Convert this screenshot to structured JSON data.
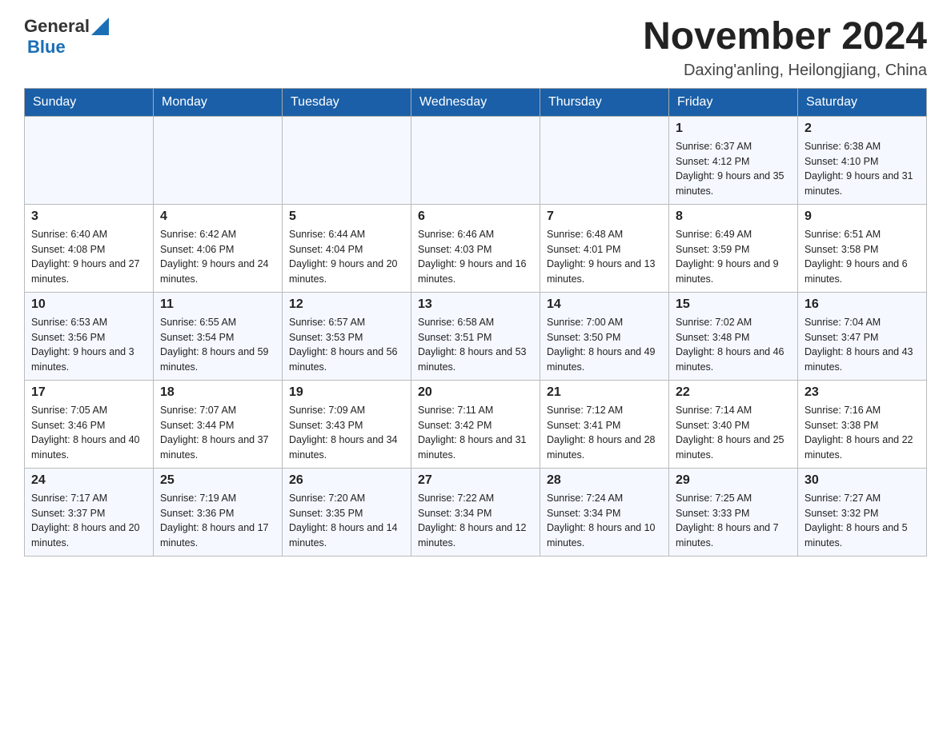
{
  "header": {
    "logo_general": "General",
    "logo_blue": "Blue",
    "month_title": "November 2024",
    "location": "Daxing'anling, Heilongjiang, China"
  },
  "weekdays": [
    "Sunday",
    "Monday",
    "Tuesday",
    "Wednesday",
    "Thursday",
    "Friday",
    "Saturday"
  ],
  "weeks": [
    [
      {
        "day": "",
        "info": ""
      },
      {
        "day": "",
        "info": ""
      },
      {
        "day": "",
        "info": ""
      },
      {
        "day": "",
        "info": ""
      },
      {
        "day": "",
        "info": ""
      },
      {
        "day": "1",
        "info": "Sunrise: 6:37 AM\nSunset: 4:12 PM\nDaylight: 9 hours and 35 minutes."
      },
      {
        "day": "2",
        "info": "Sunrise: 6:38 AM\nSunset: 4:10 PM\nDaylight: 9 hours and 31 minutes."
      }
    ],
    [
      {
        "day": "3",
        "info": "Sunrise: 6:40 AM\nSunset: 4:08 PM\nDaylight: 9 hours and 27 minutes."
      },
      {
        "day": "4",
        "info": "Sunrise: 6:42 AM\nSunset: 4:06 PM\nDaylight: 9 hours and 24 minutes."
      },
      {
        "day": "5",
        "info": "Sunrise: 6:44 AM\nSunset: 4:04 PM\nDaylight: 9 hours and 20 minutes."
      },
      {
        "day": "6",
        "info": "Sunrise: 6:46 AM\nSunset: 4:03 PM\nDaylight: 9 hours and 16 minutes."
      },
      {
        "day": "7",
        "info": "Sunrise: 6:48 AM\nSunset: 4:01 PM\nDaylight: 9 hours and 13 minutes."
      },
      {
        "day": "8",
        "info": "Sunrise: 6:49 AM\nSunset: 3:59 PM\nDaylight: 9 hours and 9 minutes."
      },
      {
        "day": "9",
        "info": "Sunrise: 6:51 AM\nSunset: 3:58 PM\nDaylight: 9 hours and 6 minutes."
      }
    ],
    [
      {
        "day": "10",
        "info": "Sunrise: 6:53 AM\nSunset: 3:56 PM\nDaylight: 9 hours and 3 minutes."
      },
      {
        "day": "11",
        "info": "Sunrise: 6:55 AM\nSunset: 3:54 PM\nDaylight: 8 hours and 59 minutes."
      },
      {
        "day": "12",
        "info": "Sunrise: 6:57 AM\nSunset: 3:53 PM\nDaylight: 8 hours and 56 minutes."
      },
      {
        "day": "13",
        "info": "Sunrise: 6:58 AM\nSunset: 3:51 PM\nDaylight: 8 hours and 53 minutes."
      },
      {
        "day": "14",
        "info": "Sunrise: 7:00 AM\nSunset: 3:50 PM\nDaylight: 8 hours and 49 minutes."
      },
      {
        "day": "15",
        "info": "Sunrise: 7:02 AM\nSunset: 3:48 PM\nDaylight: 8 hours and 46 minutes."
      },
      {
        "day": "16",
        "info": "Sunrise: 7:04 AM\nSunset: 3:47 PM\nDaylight: 8 hours and 43 minutes."
      }
    ],
    [
      {
        "day": "17",
        "info": "Sunrise: 7:05 AM\nSunset: 3:46 PM\nDaylight: 8 hours and 40 minutes."
      },
      {
        "day": "18",
        "info": "Sunrise: 7:07 AM\nSunset: 3:44 PM\nDaylight: 8 hours and 37 minutes."
      },
      {
        "day": "19",
        "info": "Sunrise: 7:09 AM\nSunset: 3:43 PM\nDaylight: 8 hours and 34 minutes."
      },
      {
        "day": "20",
        "info": "Sunrise: 7:11 AM\nSunset: 3:42 PM\nDaylight: 8 hours and 31 minutes."
      },
      {
        "day": "21",
        "info": "Sunrise: 7:12 AM\nSunset: 3:41 PM\nDaylight: 8 hours and 28 minutes."
      },
      {
        "day": "22",
        "info": "Sunrise: 7:14 AM\nSunset: 3:40 PM\nDaylight: 8 hours and 25 minutes."
      },
      {
        "day": "23",
        "info": "Sunrise: 7:16 AM\nSunset: 3:38 PM\nDaylight: 8 hours and 22 minutes."
      }
    ],
    [
      {
        "day": "24",
        "info": "Sunrise: 7:17 AM\nSunset: 3:37 PM\nDaylight: 8 hours and 20 minutes."
      },
      {
        "day": "25",
        "info": "Sunrise: 7:19 AM\nSunset: 3:36 PM\nDaylight: 8 hours and 17 minutes."
      },
      {
        "day": "26",
        "info": "Sunrise: 7:20 AM\nSunset: 3:35 PM\nDaylight: 8 hours and 14 minutes."
      },
      {
        "day": "27",
        "info": "Sunrise: 7:22 AM\nSunset: 3:34 PM\nDaylight: 8 hours and 12 minutes."
      },
      {
        "day": "28",
        "info": "Sunrise: 7:24 AM\nSunset: 3:34 PM\nDaylight: 8 hours and 10 minutes."
      },
      {
        "day": "29",
        "info": "Sunrise: 7:25 AM\nSunset: 3:33 PM\nDaylight: 8 hours and 7 minutes."
      },
      {
        "day": "30",
        "info": "Sunrise: 7:27 AM\nSunset: 3:32 PM\nDaylight: 8 hours and 5 minutes."
      }
    ]
  ]
}
